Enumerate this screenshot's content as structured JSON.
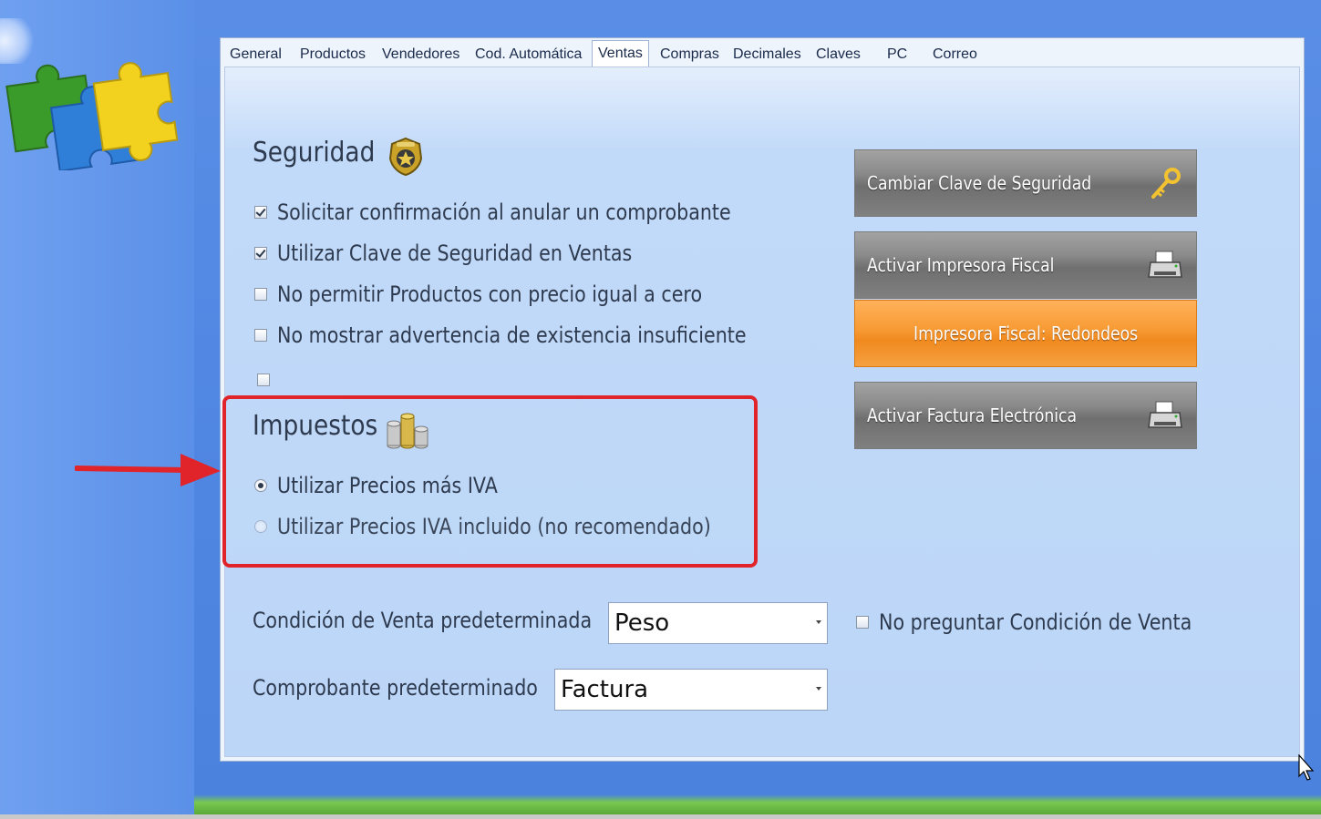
{
  "tabs": [
    {
      "label": "General",
      "active": false
    },
    {
      "label": "Productos",
      "active": false
    },
    {
      "label": "Vendedores",
      "active": false
    },
    {
      "label": "Cod. Automática",
      "active": false
    },
    {
      "label": "Ventas",
      "active": true
    },
    {
      "label": "Compras",
      "active": false
    },
    {
      "label": "Decimales",
      "active": false
    },
    {
      "label": "Claves",
      "active": false
    },
    {
      "label": "PC",
      "active": false
    },
    {
      "label": "Correo",
      "active": false
    }
  ],
  "seguridad": {
    "title": "Seguridad",
    "icon": "police-badge-icon",
    "options": [
      {
        "label": "Solicitar confirmación al anular un comprobante",
        "checked": true
      },
      {
        "label": "Utilizar Clave de Seguridad en Ventas",
        "checked": true
      },
      {
        "label": "No permitir Productos con precio igual a cero",
        "checked": false
      },
      {
        "label": "No mostrar advertencia de existencia insuficiente",
        "checked": false
      },
      {
        "label": "",
        "checked": false
      }
    ]
  },
  "impuestos": {
    "title": "Impuestos",
    "icon": "coins-icon",
    "options": [
      {
        "label": "Utilizar Precios más IVA",
        "selected": true
      },
      {
        "label": "Utilizar Precios IVA incluido (no recomendado)",
        "selected": false
      }
    ]
  },
  "buttons": {
    "cambiar_clave": "Cambiar Clave de Seguridad",
    "activar_impresora": "Activar Impresora Fiscal",
    "redondeos": "Impresora Fiscal: Redondeos",
    "activar_factura": "Activar Factura Electrónica"
  },
  "condicion": {
    "label": "Condición de Venta predeterminada",
    "value": "Peso",
    "no_preguntar_label": "No preguntar Condición de Venta",
    "no_preguntar_checked": false
  },
  "comprobante": {
    "label": "Comprobante predeterminado",
    "value": "Factura"
  },
  "colors": {
    "highlight": "#e0242a",
    "orange_button": "#f79a33",
    "tab_bg": "#bcd6f8"
  }
}
